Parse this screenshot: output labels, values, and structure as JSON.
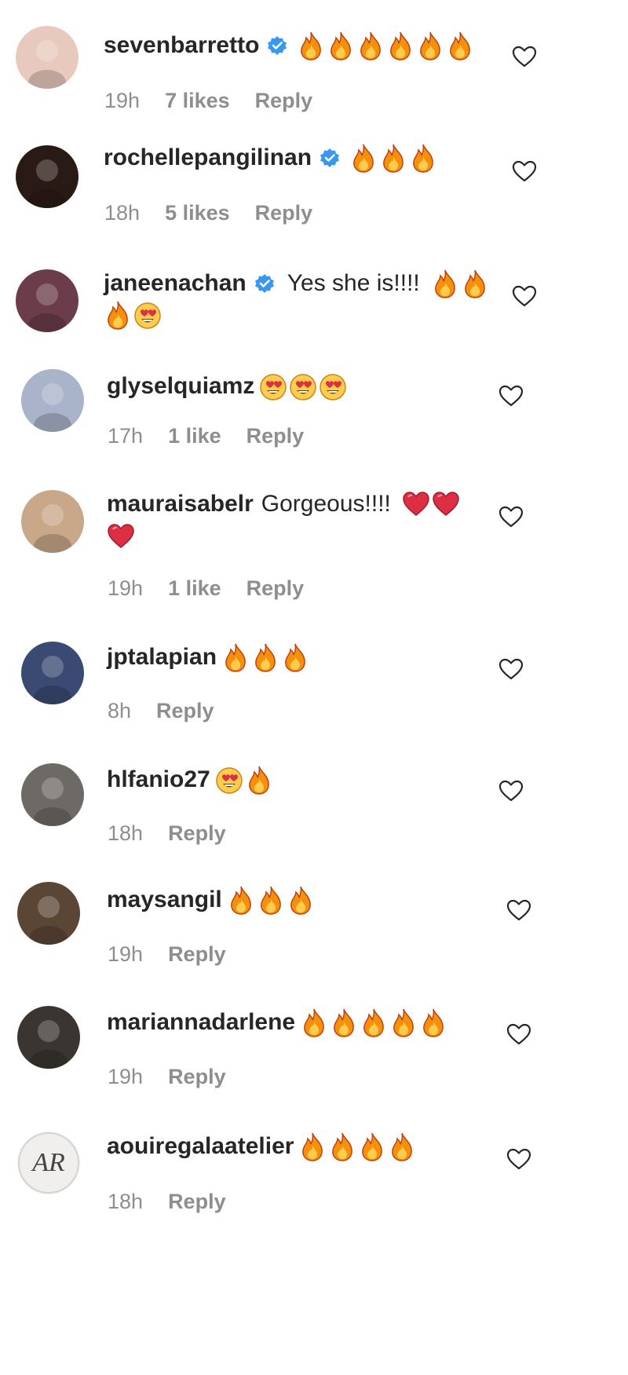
{
  "comments": [
    {
      "username": "sevenbarretto",
      "verified": true,
      "text": "",
      "emojis": [
        "fire",
        "fire",
        "fire",
        "fire",
        "fire",
        "fire"
      ],
      "emojis_line2": [],
      "time": "19h",
      "likes": "7 likes",
      "reply": "Reply",
      "avatar_color": "#e8c9bd"
    },
    {
      "username": "rochellepangilinan",
      "verified": true,
      "text": "",
      "emojis": [
        "fire",
        "fire",
        "fire"
      ],
      "emojis_line2": [],
      "time": "18h",
      "likes": "5 likes",
      "reply": "Reply",
      "avatar_color": "#2a1a16"
    },
    {
      "username": "janeenachan",
      "verified": true,
      "text": "Yes she is!!!!",
      "emojis": [
        "fire",
        "fire"
      ],
      "emojis_line2": [
        "fire",
        "heart-eyes"
      ],
      "time": "",
      "likes": "",
      "reply": "",
      "avatar_color": "#6b3d4a"
    },
    {
      "username": "glyselquiamz",
      "verified": false,
      "text": "",
      "emojis": [
        "heart-eyes",
        "heart-eyes",
        "heart-eyes"
      ],
      "emojis_line2": [],
      "time": "17h",
      "likes": "1 like",
      "reply": "Reply",
      "avatar_color": "#a9b3c9"
    },
    {
      "username": "mauraisabelr",
      "verified": false,
      "text": "Gorgeous!!!!",
      "emojis": [
        "red-heart",
        "red-heart"
      ],
      "emojis_line2": [
        "red-heart"
      ],
      "time": "19h",
      "likes": "1 like",
      "reply": "Reply",
      "avatar_color": "#c9a88a"
    },
    {
      "username": "jptalapian",
      "verified": false,
      "text": "",
      "emojis": [
        "fire",
        "fire",
        "fire"
      ],
      "emojis_line2": [],
      "time": "8h",
      "likes": "",
      "reply": "Reply",
      "avatar_color": "#3b4a73"
    },
    {
      "username": "hlfanio27",
      "verified": false,
      "text": "",
      "emojis": [
        "heart-eyes",
        "fire"
      ],
      "emojis_line2": [],
      "time": "18h",
      "likes": "",
      "reply": "Reply",
      "avatar_color": "#6d6a66"
    },
    {
      "username": "maysangil",
      "verified": false,
      "text": "",
      "emojis": [
        "fire",
        "fire",
        "fire"
      ],
      "emojis_line2": [],
      "time": "19h",
      "likes": "",
      "reply": "Reply",
      "avatar_color": "#5b4636"
    },
    {
      "username": "mariannadarlene",
      "verified": false,
      "text": "",
      "emojis": [
        "fire",
        "fire",
        "fire",
        "fire",
        "fire"
      ],
      "emojis_line2": [],
      "time": "19h",
      "likes": "",
      "reply": "Reply",
      "avatar_color": "#3a3530"
    },
    {
      "username": "aouiregalaatelier",
      "verified": false,
      "text": "",
      "emojis": [
        "fire",
        "fire",
        "fire",
        "fire"
      ],
      "emojis_line2": [],
      "time": "18h",
      "likes": "",
      "reply": "Reply",
      "avatar_color": "#f1efee",
      "avatar_monogram": "AR"
    }
  ],
  "colors": {
    "verified": "#3897f0",
    "meta": "#8e8e8e",
    "text": "#262626"
  },
  "icons": {
    "like": "heart-outline-icon",
    "verified": "verified-badge-icon"
  }
}
